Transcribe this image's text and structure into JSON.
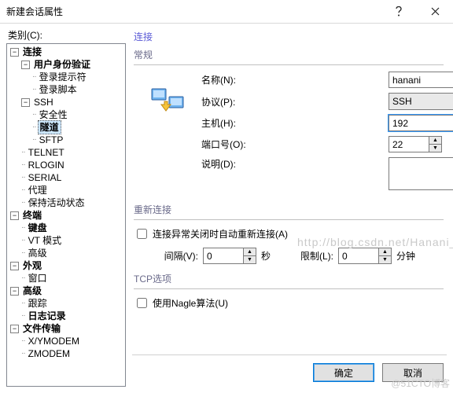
{
  "window": {
    "title": "新建会话属性"
  },
  "left_label": "类别(C):",
  "tree": {
    "connection": "连接",
    "auth": "用户身份验证",
    "login_prompt": "登录提示符",
    "login_script": "登录脚本",
    "ssh": "SSH",
    "security": "安全性",
    "tunnel": "隧道",
    "sftp": "SFTP",
    "telnet": "TELNET",
    "rlogin": "RLOGIN",
    "serial": "SERIAL",
    "proxy": "代理",
    "keepalive": "保持活动状态",
    "terminal": "终端",
    "keyboard": "键盘",
    "vtmode": "VT 模式",
    "advanced_term": "高级",
    "appearance": "外观",
    "window": "窗口",
    "advanced": "高级",
    "trace": "跟踪",
    "logging": "日志记录",
    "file_transfer": "文件传输",
    "xymodem": "X/YMODEM",
    "zmodem": "ZMODEM"
  },
  "panel": {
    "header": "连接",
    "general": "常规",
    "name_lbl": "名称(N):",
    "protocol_lbl": "协议(P):",
    "host_lbl": "主机(H):",
    "port_lbl": "端口号(O):",
    "desc_lbl": "说明(D):",
    "name_val": "hanani",
    "protocol_val": "SSH",
    "host_val": "192",
    "port_val": "22",
    "desc_val": "",
    "reconnect": "重新连接",
    "reconnect_chk": "连接异常关闭时自动重新连接(A)",
    "interval_lbl": "间隔(V):",
    "interval_val": "0",
    "interval_unit": "秒",
    "limit_lbl": "限制(L):",
    "limit_val": "0",
    "limit_unit": "分钟",
    "tcp": "TCP选项",
    "nagle_chk": "使用Nagle算法(U)"
  },
  "buttons": {
    "ok": "确定",
    "cancel": "取消"
  },
  "wm": "http://blog.csdn.net/Hanani_Jia",
  "wm2": "@51CTO博客"
}
